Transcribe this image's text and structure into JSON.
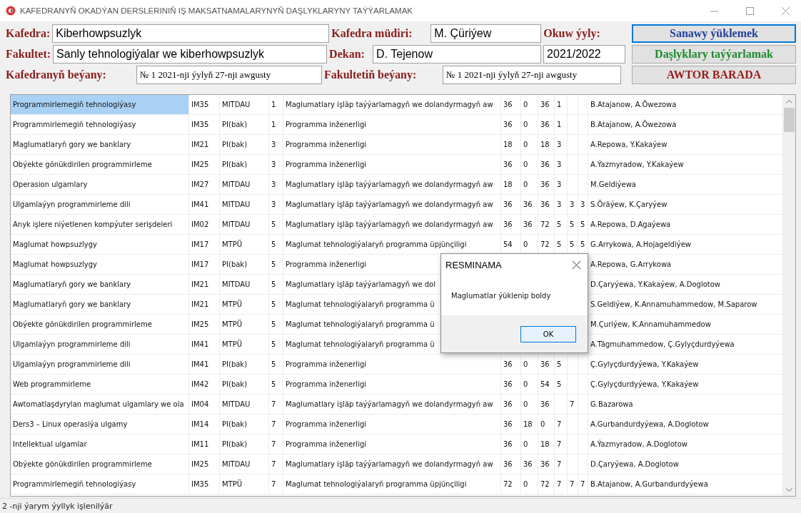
{
  "window": {
    "title": "KAFEDRANYŇ OKADÝAN DERSLERINIŇ IŞ MAKSATNAMALARYNYŇ DAŞLYKLARYNY TAÝÝARLAMAK"
  },
  "form": {
    "rows": [
      {
        "items": [
          {
            "kind": "label",
            "text": "Kafedra:"
          },
          {
            "kind": "field",
            "value": "Kiberhowpsuzlyk"
          },
          {
            "kind": "label",
            "text": "Kafedra müdiri:"
          },
          {
            "kind": "field",
            "value": "M. Çüriýew"
          },
          {
            "kind": "label",
            "text": "Okuw ýyly:"
          },
          {
            "kind": "button",
            "text": "Sanawy ýüklemek",
            "color": "#1f3f9a",
            "focused": true
          }
        ]
      },
      {
        "items": [
          {
            "kind": "label",
            "text": "Fakultet:"
          },
          {
            "kind": "field",
            "value": "Sanly tehnologiýalar we kiberhowpsuzlyk"
          },
          {
            "kind": "label",
            "text": "Dekan:"
          },
          {
            "kind": "field",
            "value": "D. Tejenow"
          },
          {
            "kind": "field",
            "value": "2021/2022"
          },
          {
            "kind": "button",
            "text": "Daşlyklary taýýarlamak",
            "color": "#1e8a2e",
            "focused": false
          }
        ]
      },
      {
        "items": [
          {
            "kind": "label",
            "text": "Kafedranyň beýany:"
          },
          {
            "kind": "field",
            "value": "№ 1 2021-nji ýylyň 27-nji awgusty",
            "serif": true
          },
          {
            "kind": "label",
            "text": "Fakultetiň beýany:"
          },
          {
            "kind": "field",
            "value": "№ 1 2021-nji ýylyň 27-nji awgusty",
            "serif": true
          },
          {
            "kind": "button",
            "text": "AWTOR BARADA",
            "color": "#9a1c1c",
            "focused": false
          }
        ]
      }
    ]
  },
  "table": {
    "rows": [
      {
        "selected": true,
        "cells": [
          "Programmirlemegiň tehnologiýasy",
          "IM35",
          "MITDAU",
          "1",
          "Maglumatlary işläp taýýarlamagyň we dolandyrmagyň aw",
          "36",
          "0",
          "36",
          "1",
          null,
          null,
          "B.Atajanow, A.Öwezowa"
        ]
      },
      {
        "selected": false,
        "cells": [
          "Programmirlemegiň tehnologiýasy",
          "IM35",
          "PI(bak)",
          "1",
          "Programma inženerligi",
          "36",
          "0",
          "36",
          "1",
          null,
          null,
          "B.Atajanow, A.Öwezowa"
        ]
      },
      {
        "selected": false,
        "cells": [
          "Maglumatlaryň gory we banklary",
          "IM21",
          "PI(bak)",
          "3",
          "Programma inženerligi",
          "18",
          "0",
          "18",
          "3",
          null,
          null,
          "A.Repowa, Y.Kakaýew"
        ]
      },
      {
        "selected": false,
        "cells": [
          "Obýekte gönükdirilen programmirleme",
          "IM25",
          "PI(bak)",
          "3",
          "Programma inženerligi",
          "36",
          "0",
          "36",
          "3",
          null,
          null,
          "A.Ýazmyradow, Y.Kakaýew"
        ]
      },
      {
        "selected": false,
        "cells": [
          "Operasion ulgamlary",
          "IM27",
          "MITDAU",
          "3",
          "Maglumatlary işläp taýýarlamagyň we dolandyrmagyň aw",
          "18",
          "0",
          "36",
          "3",
          null,
          null,
          "M.Geldiýewa"
        ]
      },
      {
        "selected": false,
        "cells": [
          "Ulgamlaýyn programmirleme dili",
          "IM41",
          "MITDAU",
          "3",
          "Maglumatlary işläp taýýarlamagyň we dolandyrmagyň aw",
          "36",
          "36",
          "36",
          "3",
          "3",
          "3",
          "S.Öräýew, K.Çaryýew"
        ]
      },
      {
        "selected": false,
        "cells": [
          "Anyk işlere niýetlenen kompýuter serişdeleri",
          "IM02",
          "MITDAU",
          "5",
          "Maglumatlary işläp taýýarlamagyň we dolandyrmagyň aw",
          "36",
          "36",
          "72",
          "5",
          "5",
          "5",
          "A.Repowa, D.Agaýewa"
        ]
      },
      {
        "selected": false,
        "cells": [
          "Maglumat howpsuzlygy",
          "IM17",
          "MTPÜ",
          "5",
          "Maglumat tehnologiýalaryň programma üpjünçiligi",
          "54",
          "0",
          "72",
          "5",
          "5",
          "5",
          "G.Arrykowa, A.Hojageldiýew"
        ]
      },
      {
        "selected": false,
        "cells": [
          "Maglumat howpsuzlygy",
          "IM17",
          "PI(bak)",
          "5",
          "Programma inženerligi",
          null,
          null,
          null,
          null,
          null,
          null,
          "A.Repowa, G.Arrykowa"
        ]
      },
      {
        "selected": false,
        "cells": [
          "Maglumatlaryň gory we banklary",
          "IM21",
          "MITDAU",
          "5",
          "Maglumatlary işläp taýýarlamagyň we dol",
          null,
          null,
          null,
          null,
          null,
          null,
          "D.Çaryýewa, Y.Kakaýew, A.Doglotow"
        ]
      },
      {
        "selected": false,
        "cells": [
          "Maglumatlaryň gory we banklary",
          "IM21",
          "MTPÜ",
          "5",
          "Maglumat tehnologiýalaryň programma ü",
          null,
          null,
          null,
          null,
          null,
          null,
          "S.Geldiýew, K.Annamuhammedow, M.Saparow"
        ]
      },
      {
        "selected": false,
        "cells": [
          "Obýekte gönükdirilen programmirleme",
          "IM25",
          "MTPÜ",
          "5",
          "Maglumat tehnologiýalaryň programma ü",
          null,
          null,
          null,
          null,
          null,
          null,
          "M.Çuriýew, K.Annamuhammedow"
        ]
      },
      {
        "selected": false,
        "cells": [
          "Ulgamlaýyn programmirleme dili",
          "IM41",
          "MTPÜ",
          "5",
          "Maglumat tehnologiýalaryň programma ü",
          null,
          null,
          null,
          null,
          null,
          null,
          "A.Tägmuhammedow, Ç.Gylyçdurdyýewa"
        ]
      },
      {
        "selected": false,
        "cells": [
          "Ulgamlaýyn programmirleme dili",
          "IM41",
          "PI(bak)",
          "5",
          "Programma inženerligi",
          "36",
          "0",
          "36",
          "5",
          null,
          null,
          "Ç.Gylyçdurdyýewa, Y.Kakaýew"
        ]
      },
      {
        "selected": false,
        "cells": [
          "Web programmirleme",
          "IM42",
          "PI(bak)",
          "5",
          "Programma inženerligi",
          "36",
          "0",
          "54",
          "5",
          null,
          null,
          "Ç.Gylyçdurdyýewa, Y.Kakaýew"
        ]
      },
      {
        "selected": false,
        "cells": [
          "Awtomatlaşdyrylan maglumat ulgamlary we ola",
          "IM04",
          "MITDAU",
          "7",
          "Maglumatlary işläp taýýarlamagyň we dolandyrmagyň aw",
          "36",
          "0",
          "36",
          null,
          "7",
          null,
          "G.Bazarowa"
        ]
      },
      {
        "selected": false,
        "cells": [
          "Ders3 – Linux operasiýa ulgamy",
          "IM14",
          "PI(bak)",
          "7",
          "Programma inženerligi",
          "36",
          "18",
          "0",
          "7",
          null,
          null,
          "A.Gurbandurdyýewa, A.Doglotow"
        ]
      },
      {
        "selected": false,
        "cells": [
          "Intellektual ulgamlar",
          "IM11",
          "PI(bak)",
          "7",
          "Programma inženerligi",
          "36",
          "0",
          "18",
          "7",
          null,
          null,
          "A.Ýazmyradow, A.Doglotow"
        ]
      },
      {
        "selected": false,
        "cells": [
          "Obýekte gönükdirilen programmirleme",
          "IM25",
          "MITDAU",
          "7",
          "Maglumatlary işläp taýýarlamagyň we dolandyrmagyň aw",
          "36",
          "36",
          "36",
          "7",
          null,
          null,
          "D.Çaryýewa, A.Doglotow"
        ]
      },
      {
        "selected": false,
        "cells": [
          "Programmirlemegiň tehnologiýasy",
          "IM35",
          "MTPÜ",
          "7",
          "Maglumat tehnologiýalaryň programma üpjünçiligi",
          "72",
          "0",
          "72",
          "7",
          "7",
          "7",
          "B.Atajanow, A.Gurbandurdyýewa"
        ]
      }
    ]
  },
  "dialog": {
    "title": "RESMINAMA",
    "message": "Maglumatlar ýüklenip boldy",
    "button": "OK"
  },
  "status_bar": {
    "text": "2 -nji ýarym ýyllyk işlenilýär"
  }
}
